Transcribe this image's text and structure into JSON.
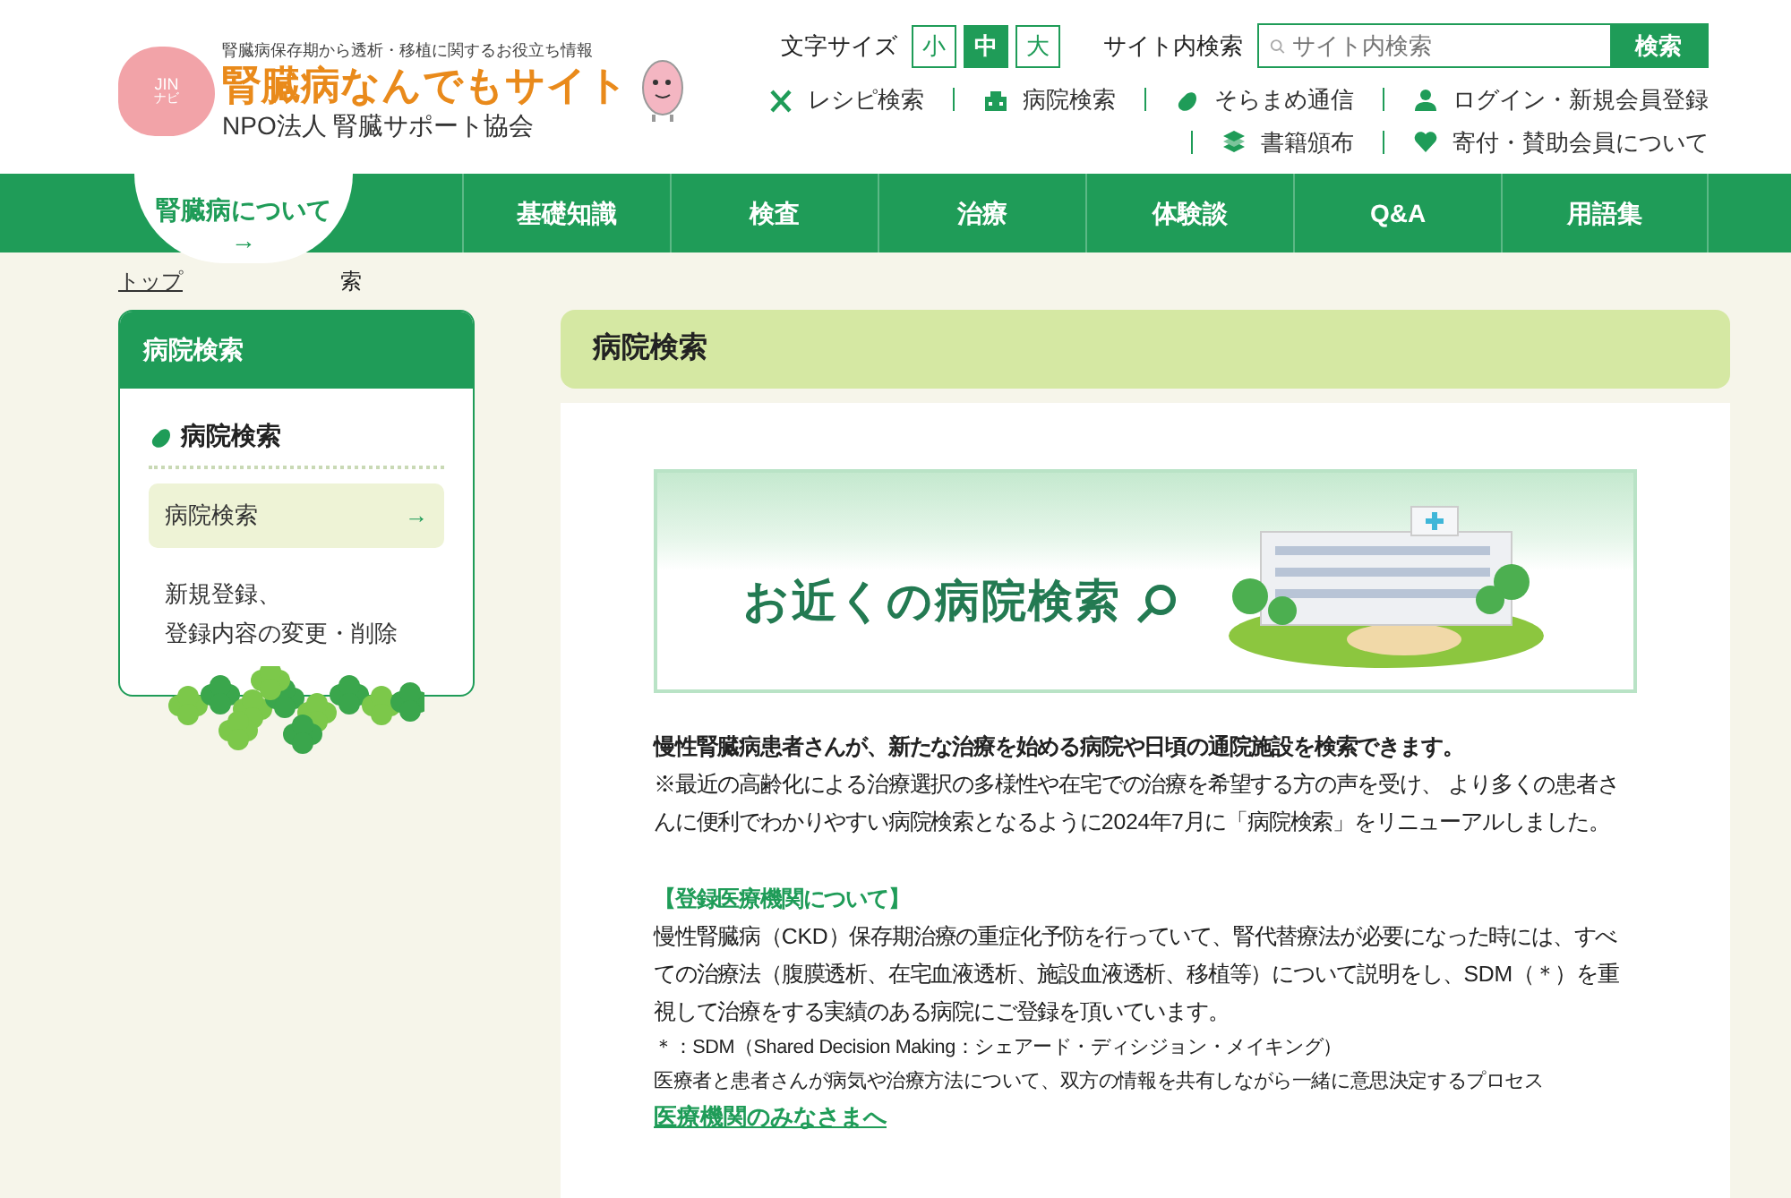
{
  "header": {
    "logo_mark": "JIN",
    "logo_sub": "ナビ",
    "tagline": "腎臓病保存期から透析・移植に関するお役立ち情報",
    "site_title": "腎臓病なんでもサイト",
    "org": "NPO法人 腎臓サポート協会"
  },
  "font_size": {
    "label": "文字サイズ",
    "options": [
      {
        "label": "小",
        "selected": false
      },
      {
        "label": "中",
        "selected": true
      },
      {
        "label": "大",
        "selected": false
      }
    ]
  },
  "search": {
    "label": "サイト内検索",
    "placeholder": "サイト内検索",
    "button": "検索"
  },
  "utility_links": [
    [
      {
        "label": "レシピ検索"
      },
      {
        "label": "病院検索"
      },
      {
        "label": "そらまめ通信"
      },
      {
        "label": "ログイン・新規会員登録"
      }
    ],
    [
      {
        "label": "書籍頒布"
      },
      {
        "label": "寄付・賛助会員について"
      }
    ]
  ],
  "nav": [
    {
      "label": "腎臓病について",
      "selected": true,
      "arrow": "→"
    },
    {
      "label": "基礎知識",
      "selected": false
    },
    {
      "label": "検査",
      "selected": false
    },
    {
      "label": "治療",
      "selected": false
    },
    {
      "label": "体験談",
      "selected": false
    },
    {
      "label": "Q&A",
      "selected": false
    },
    {
      "label": "用語集",
      "selected": false
    }
  ],
  "breadcrumb": [
    {
      "label": "トップ",
      "kind": "link"
    },
    {
      "label": "索",
      "kind": "text"
    }
  ],
  "sidebar": {
    "title": "病院検索",
    "section": "病院検索",
    "items": [
      {
        "label": "病院検索",
        "selected": true,
        "arrow": "→"
      },
      {
        "lines": [
          "新規登録、",
          "登録内容の変更・削除"
        ],
        "selected": false
      }
    ]
  },
  "main": {
    "title": "病院検索",
    "banner": "お近くの病院検索",
    "lead": "慢性腎臓病患者さんが、新たな治療を始める病院や日頃の通院施設を検索できます。",
    "note": "※最近の高齢化による治療選択の多様性や在宅での治療を希望する方の声を受け、 より多くの患者さんに便利でわかりやすい病院検索となるように2024年7月に「病院検索」をリニューアルしました。",
    "section_heading": "【登録医療機関について】",
    "body": "慢性腎臓病（CKD）保存期治療の重症化予防を行っていて、腎代替療法が必要になった時には、すべての治療法（腹膜透析、在宅血液透析、施設血液透析、移植等）について説明をし、SDM（＊）を重視して治療をする実績のある病院にご登録を頂いています。",
    "footnote": "＊：SDM（Shared Decision Making：シェアード・ディシジョン・メイキング）",
    "footnote_desc": "医療者と患者さんが病気や治療方法について、双方の情報を共有しながら一緒に意思決定するプロセス",
    "link": "医療機関のみなさまへ"
  }
}
